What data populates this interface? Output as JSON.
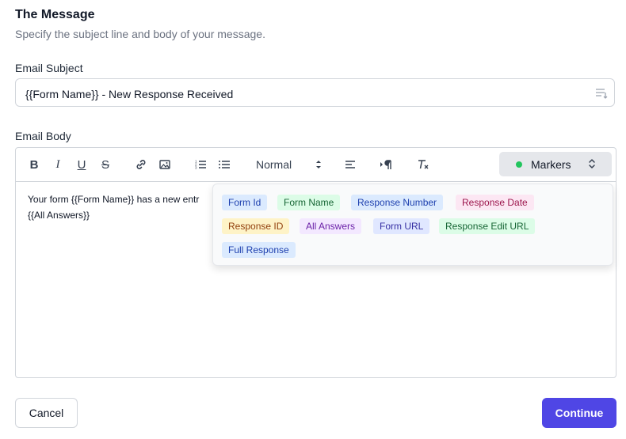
{
  "section": {
    "title": "The Message",
    "subtitle": "Specify the subject line and body of your message."
  },
  "subject": {
    "label": "Email Subject",
    "value": "{{Form Name}} - New Response Received"
  },
  "body": {
    "label": "Email Body",
    "line1": "Your form {{Form Name}} has a new entr",
    "line2": "{{All Answers}}"
  },
  "toolbar": {
    "bold": "B",
    "italic": "I",
    "underline": "U",
    "strike": "S",
    "format_select": "Normal",
    "markers_label": "Markers",
    "markers_status_color": "#22c55e"
  },
  "markers": [
    {
      "label": "Form Id",
      "bg": "#dbeafe",
      "color": "#1e40af"
    },
    {
      "label": "Form Name",
      "bg": "#dcfce7",
      "color": "#166534"
    },
    {
      "label": "Response Number",
      "bg": "#dbeafe",
      "color": "#1e40af"
    },
    {
      "label": "Response Date",
      "bg": "#fce7f3",
      "color": "#9d174d"
    },
    {
      "label": "Response ID",
      "bg": "#fef3c7",
      "color": "#92400e"
    },
    {
      "label": "All Answers",
      "bg": "#f3e8ff",
      "color": "#6b21a8"
    },
    {
      "label": "Form URL",
      "bg": "#e0e7ff",
      "color": "#3730a3"
    },
    {
      "label": "Response Edit URL",
      "bg": "#dcfce7",
      "color": "#166534"
    },
    {
      "label": "Full Response",
      "bg": "#dbeafe",
      "color": "#1e40af"
    }
  ],
  "actions": {
    "cancel": "Cancel",
    "continue": "Continue"
  },
  "colors": {
    "accent": "#4f46e5"
  }
}
